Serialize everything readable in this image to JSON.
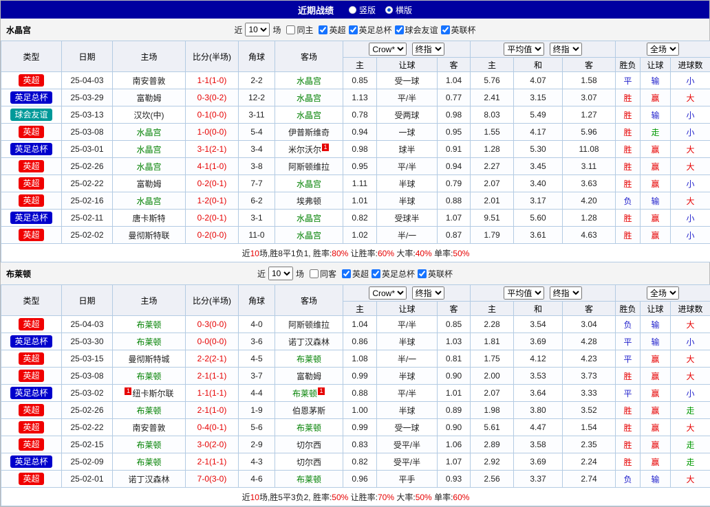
{
  "header": {
    "title": "近期战绩",
    "views": [
      {
        "label": "竖版",
        "selected": false
      },
      {
        "label": "横版",
        "selected": true
      }
    ]
  },
  "labels": {
    "near": "近",
    "count": "10",
    "matches": "场"
  },
  "table_header": {
    "type": "类型",
    "date": "日期",
    "home": "主场",
    "score": "比分(半场)",
    "corner": "角球",
    "away": "客场",
    "odds_selects": [
      "Crow*",
      "终指"
    ],
    "avg_selects": [
      "平均值",
      "终指"
    ],
    "scope_select": "全场",
    "odds_cols": [
      "主",
      "让球",
      "客"
    ],
    "avg_cols": [
      "主",
      "和",
      "客"
    ],
    "result_cols": [
      "胜负",
      "让球",
      "进球数"
    ]
  },
  "colors": {
    "topbar_bg": "#0000a0",
    "league_premier": "#f00000",
    "league_fa_cup": "#0000cc",
    "league_friendly": "#009999",
    "win_text": "#e60000",
    "loss_text": "#2222cc",
    "push_text": "#009900",
    "score_text": "#e60000",
    "focus_team_text": "#008000",
    "grid_border": "#b3cbe3",
    "header_bg": "#eef0f6"
  },
  "sections": [
    {
      "team": "水晶宫",
      "same_side_label": "同主",
      "leagues": [
        "英超",
        "英足总杯",
        "球会友谊",
        "英联杯"
      ],
      "rows": [
        {
          "type": "英超",
          "date": "25-04-03",
          "home": {
            "name": "南安普敦"
          },
          "score": "1-1(1-0)",
          "corner": "2-2",
          "away": {
            "name": "水晶宫"
          },
          "odds": [
            "0.85",
            "受一球",
            "1.04"
          ],
          "avg": [
            "5.76",
            "4.07",
            "1.58"
          ],
          "result": "平",
          "handicap": "输",
          "goals": "小"
        },
        {
          "type": "英足总杯",
          "date": "25-03-29",
          "home": {
            "name": "富勒姆"
          },
          "score": "0-3(0-2)",
          "corner": "12-2",
          "away": {
            "name": "水晶宫"
          },
          "odds": [
            "1.13",
            "平/半",
            "0.77"
          ],
          "avg": [
            "2.41",
            "3.15",
            "3.07"
          ],
          "result": "胜",
          "handicap": "赢",
          "goals": "大"
        },
        {
          "type": "球会友谊",
          "date": "25-03-13",
          "home": {
            "name": "汉坎(中)"
          },
          "score": "0-1(0-0)",
          "corner": "3-11",
          "away": {
            "name": "水晶宫"
          },
          "odds": [
            "0.78",
            "受两球",
            "0.98"
          ],
          "avg": [
            "8.03",
            "5.49",
            "1.27"
          ],
          "result": "胜",
          "handicap": "输",
          "goals": "小"
        },
        {
          "type": "英超",
          "date": "25-03-08",
          "home": {
            "name": "水晶宫"
          },
          "score": "1-0(0-0)",
          "corner": "5-4",
          "away": {
            "name": "伊普斯维奇"
          },
          "odds": [
            "0.94",
            "一球",
            "0.95"
          ],
          "avg": [
            "1.55",
            "4.17",
            "5.96"
          ],
          "result": "胜",
          "handicap": "走",
          "goals": "小"
        },
        {
          "type": "英足总杯",
          "date": "25-03-01",
          "home": {
            "name": "水晶宫"
          },
          "score": "3-1(2-1)",
          "corner": "3-4",
          "away": {
            "name": "米尔沃尔",
            "card_after": "1"
          },
          "odds": [
            "0.98",
            "球半",
            "0.91"
          ],
          "avg": [
            "1.28",
            "5.30",
            "11.08"
          ],
          "result": "胜",
          "handicap": "赢",
          "goals": "大"
        },
        {
          "type": "英超",
          "date": "25-02-26",
          "home": {
            "name": "水晶宫"
          },
          "score": "4-1(1-0)",
          "corner": "3-8",
          "away": {
            "name": "阿斯顿维拉"
          },
          "odds": [
            "0.95",
            "平/半",
            "0.94"
          ],
          "avg": [
            "2.27",
            "3.45",
            "3.11"
          ],
          "result": "胜",
          "handicap": "赢",
          "goals": "大"
        },
        {
          "type": "英超",
          "date": "25-02-22",
          "home": {
            "name": "富勒姆"
          },
          "score": "0-2(0-1)",
          "corner": "7-7",
          "away": {
            "name": "水晶宫"
          },
          "odds": [
            "1.11",
            "半球",
            "0.79"
          ],
          "avg": [
            "2.07",
            "3.40",
            "3.63"
          ],
          "result": "胜",
          "handicap": "赢",
          "goals": "小"
        },
        {
          "type": "英超",
          "date": "25-02-16",
          "home": {
            "name": "水晶宫"
          },
          "score": "1-2(0-1)",
          "corner": "6-2",
          "away": {
            "name": "埃弗顿"
          },
          "odds": [
            "1.01",
            "半球",
            "0.88"
          ],
          "avg": [
            "2.01",
            "3.17",
            "4.20"
          ],
          "result": "负",
          "handicap": "输",
          "goals": "大"
        },
        {
          "type": "英足总杯",
          "date": "25-02-11",
          "home": {
            "name": "唐卡斯特"
          },
          "score": "0-2(0-1)",
          "corner": "3-1",
          "away": {
            "name": "水晶宫"
          },
          "odds": [
            "0.82",
            "受球半",
            "1.07"
          ],
          "avg": [
            "9.51",
            "5.60",
            "1.28"
          ],
          "result": "胜",
          "handicap": "赢",
          "goals": "小"
        },
        {
          "type": "英超",
          "date": "25-02-02",
          "home": {
            "name": "曼彻斯特联"
          },
          "score": "0-2(0-0)",
          "corner": "11-0",
          "away": {
            "name": "水晶宫"
          },
          "odds": [
            "1.02",
            "半/一",
            "0.87"
          ],
          "avg": [
            "1.79",
            "3.61",
            "4.63"
          ],
          "result": "胜",
          "handicap": "赢",
          "goals": "小"
        }
      ],
      "summary": [
        {
          "t": "近",
          "c": "k"
        },
        {
          "t": "10",
          "c": "r"
        },
        {
          "t": "场,胜8平1负1, 胜率:",
          "c": "k"
        },
        {
          "t": "80%",
          "c": "r"
        },
        {
          "t": " 让胜率:",
          "c": "k"
        },
        {
          "t": "60%",
          "c": "r"
        },
        {
          "t": " 大率:",
          "c": "k"
        },
        {
          "t": "40%",
          "c": "r"
        },
        {
          "t": " 单率:",
          "c": "k"
        },
        {
          "t": "50%",
          "c": "r"
        }
      ]
    },
    {
      "team": "布莱顿",
      "same_side_label": "同客",
      "leagues": [
        "英超",
        "英足总杯",
        "英联杯"
      ],
      "rows": [
        {
          "type": "英超",
          "date": "25-04-03",
          "home": {
            "name": "布莱顿"
          },
          "score": "0-3(0-0)",
          "corner": "4-0",
          "away": {
            "name": "阿斯顿维拉"
          },
          "odds": [
            "1.04",
            "平/半",
            "0.85"
          ],
          "avg": [
            "2.28",
            "3.54",
            "3.04"
          ],
          "result": "负",
          "handicap": "输",
          "goals": "大"
        },
        {
          "type": "英足总杯",
          "date": "25-03-30",
          "home": {
            "name": "布莱顿"
          },
          "score": "0-0(0-0)",
          "corner": "3-6",
          "away": {
            "name": "诺丁汉森林"
          },
          "odds": [
            "0.86",
            "半球",
            "1.03"
          ],
          "avg": [
            "1.81",
            "3.69",
            "4.28"
          ],
          "result": "平",
          "handicap": "输",
          "goals": "小"
        },
        {
          "type": "英超",
          "date": "25-03-15",
          "home": {
            "name": "曼彻斯特城"
          },
          "score": "2-2(2-1)",
          "corner": "4-5",
          "away": {
            "name": "布莱顿"
          },
          "odds": [
            "1.08",
            "半/一",
            "0.81"
          ],
          "avg": [
            "1.75",
            "4.12",
            "4.23"
          ],
          "result": "平",
          "handicap": "赢",
          "goals": "大"
        },
        {
          "type": "英超",
          "date": "25-03-08",
          "home": {
            "name": "布莱顿"
          },
          "score": "2-1(1-1)",
          "corner": "3-7",
          "away": {
            "name": "富勒姆"
          },
          "odds": [
            "0.99",
            "半球",
            "0.90"
          ],
          "avg": [
            "2.00",
            "3.53",
            "3.73"
          ],
          "result": "胜",
          "handicap": "赢",
          "goals": "大"
        },
        {
          "type": "英足总杯",
          "date": "25-03-02",
          "home": {
            "name": "纽卡斯尔联",
            "card_before": "1"
          },
          "score": "1-1(1-1)",
          "corner": "4-4",
          "away": {
            "name": "布莱顿",
            "card_after": "1"
          },
          "odds": [
            "0.88",
            "平/半",
            "1.01"
          ],
          "avg": [
            "2.07",
            "3.64",
            "3.33"
          ],
          "result": "平",
          "handicap": "赢",
          "goals": "小"
        },
        {
          "type": "英超",
          "date": "25-02-26",
          "home": {
            "name": "布莱顿"
          },
          "score": "2-1(1-0)",
          "corner": "1-9",
          "away": {
            "name": "伯恩茅斯"
          },
          "odds": [
            "1.00",
            "半球",
            "0.89"
          ],
          "avg": [
            "1.98",
            "3.80",
            "3.52"
          ],
          "result": "胜",
          "handicap": "赢",
          "goals": "走"
        },
        {
          "type": "英超",
          "date": "25-02-22",
          "home": {
            "name": "南安普敦"
          },
          "score": "0-4(0-1)",
          "corner": "5-6",
          "away": {
            "name": "布莱顿"
          },
          "odds": [
            "0.99",
            "受一球",
            "0.90"
          ],
          "avg": [
            "5.61",
            "4.47",
            "1.54"
          ],
          "result": "胜",
          "handicap": "赢",
          "goals": "大"
        },
        {
          "type": "英超",
          "date": "25-02-15",
          "home": {
            "name": "布莱顿"
          },
          "score": "3-0(2-0)",
          "corner": "2-9",
          "away": {
            "name": "切尔西"
          },
          "odds": [
            "0.83",
            "受平/半",
            "1.06"
          ],
          "avg": [
            "2.89",
            "3.58",
            "2.35"
          ],
          "result": "胜",
          "handicap": "赢",
          "goals": "走"
        },
        {
          "type": "英足总杯",
          "date": "25-02-09",
          "home": {
            "name": "布莱顿"
          },
          "score": "2-1(1-1)",
          "corner": "4-3",
          "away": {
            "name": "切尔西"
          },
          "odds": [
            "0.82",
            "受平/半",
            "1.07"
          ],
          "avg": [
            "2.92",
            "3.69",
            "2.24"
          ],
          "result": "胜",
          "handicap": "赢",
          "goals": "走"
        },
        {
          "type": "英超",
          "date": "25-02-01",
          "home": {
            "name": "诺丁汉森林"
          },
          "score": "7-0(3-0)",
          "corner": "4-6",
          "away": {
            "name": "布莱顿"
          },
          "odds": [
            "0.96",
            "平手",
            "0.93"
          ],
          "avg": [
            "2.56",
            "3.37",
            "2.74"
          ],
          "result": "负",
          "handicap": "输",
          "goals": "大"
        }
      ],
      "summary": [
        {
          "t": "近",
          "c": "k"
        },
        {
          "t": "10",
          "c": "r"
        },
        {
          "t": "场,胜5平3负2, 胜率:",
          "c": "k"
        },
        {
          "t": "50%",
          "c": "r"
        },
        {
          "t": " 让胜率:",
          "c": "k"
        },
        {
          "t": "70%",
          "c": "r"
        },
        {
          "t": " 大率:",
          "c": "k"
        },
        {
          "t": "50%",
          "c": "r"
        },
        {
          "t": " 单率:",
          "c": "k"
        },
        {
          "t": "60%",
          "c": "r"
        }
      ]
    }
  ]
}
